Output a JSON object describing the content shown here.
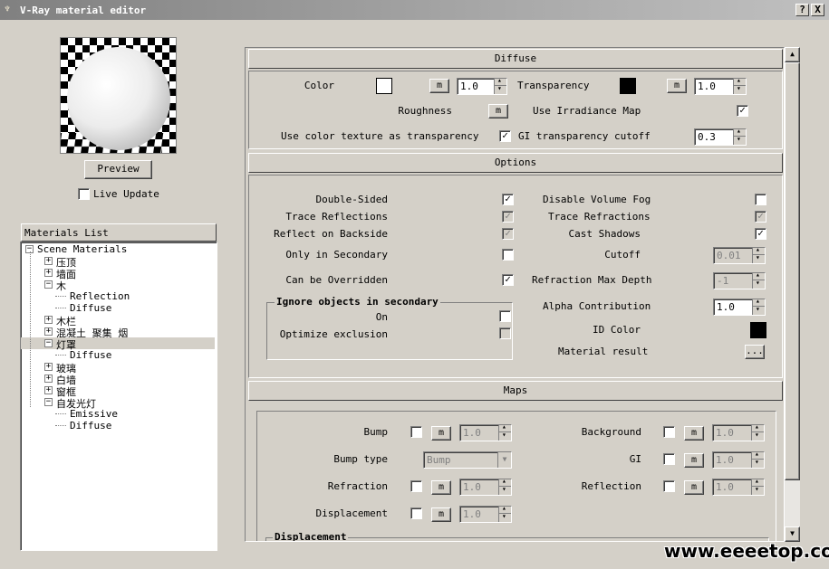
{
  "window": {
    "title": "V-Ray material editor",
    "help_label": "?",
    "close_label": "X"
  },
  "preview": {
    "button_label": "Preview",
    "live_update_label": "Live Update",
    "live_update_checked": false
  },
  "materials_list": {
    "header": "Materials List",
    "items": [
      {
        "label": "Scene Materials",
        "level": 0,
        "expander": "−"
      },
      {
        "label": "压顶",
        "level": 1,
        "expander": "+"
      },
      {
        "label": "墙面",
        "level": 1,
        "expander": "+"
      },
      {
        "label": "木",
        "level": 1,
        "expander": "−"
      },
      {
        "label": "Reflection",
        "level": 2,
        "expander": ""
      },
      {
        "label": "Diffuse",
        "level": 2,
        "expander": ""
      },
      {
        "label": "木栏",
        "level": 1,
        "expander": "+"
      },
      {
        "label": "混凝土_聚集_烟",
        "level": 1,
        "expander": "+"
      },
      {
        "label": "灯罩",
        "level": 1,
        "expander": "−",
        "selected": true
      },
      {
        "label": "Diffuse",
        "level": 2,
        "expander": ""
      },
      {
        "label": "玻璃",
        "level": 1,
        "expander": "+"
      },
      {
        "label": "白墙",
        "level": 1,
        "expander": "+"
      },
      {
        "label": "窗框",
        "level": 1,
        "expander": "+"
      },
      {
        "label": "自发光灯",
        "level": 1,
        "expander": "−"
      },
      {
        "label": "Emissive",
        "level": 2,
        "expander": ""
      },
      {
        "label": "Diffuse",
        "level": 2,
        "expander": ""
      }
    ]
  },
  "diffuse": {
    "header": "Diffuse",
    "color_label": "Color",
    "color_value": "#ffffff",
    "color_mult": "1.0",
    "transparency_label": "Transparency",
    "transparency_value": "#000000",
    "transparency_mult": "1.0",
    "roughness_label": "Roughness",
    "irradiance_label": "Use Irradiance Map",
    "irradiance_checked": true,
    "texture_transp_label": "Use color texture as transparency",
    "texture_transp_checked": true,
    "gi_cutoff_label": "GI transparency cutoff",
    "gi_cutoff_value": "0.3",
    "map_button": "m"
  },
  "options": {
    "header": "Options",
    "double_sided": "Double-Sided",
    "trace_reflections": "Trace Reflections",
    "reflect_backside": "Reflect on Backside",
    "only_secondary": "Only in Secondary",
    "can_override": "Can be Overridden",
    "disable_fog": "Disable Volume Fog",
    "trace_refractions": "Trace Refractions",
    "cast_shadows": "Cast Shadows",
    "cutoff_label": "Cutoff",
    "cutoff_value": "0.01",
    "refr_depth_label": "Refraction Max Depth",
    "refr_depth_value": "-1",
    "alpha_label": "Alpha Contribution",
    "alpha_value": "1.0",
    "id_color_label": "ID Color",
    "id_color_value": "#000000",
    "material_result_label": "Material result",
    "material_result_button": "...",
    "ignore_group_label": "Ignore objects in secondary",
    "on_label": "On",
    "optimize_label": "Optimize exclusion",
    "check_mark": "✓"
  },
  "maps": {
    "header": "Maps",
    "bump_label": "Bump",
    "bump_value": "1.0",
    "bump_type_label": "Bump type",
    "bump_type_value": "Bump",
    "refraction_label": "Refraction",
    "refraction_value": "1.0",
    "displacement_label": "Displacement",
    "displacement_value": "1.0",
    "background_label": "Background",
    "background_value": "1.0",
    "gi_label": "GI",
    "gi_value": "1.0",
    "reflection_label": "Reflection",
    "reflection_value": "1.0",
    "displacement_group_label": "Displacement"
  },
  "watermark": "www.eeeetop.com",
  "colors": {
    "face": "#d4d0c8",
    "highlight": "#ffffff",
    "shadow": "#808080",
    "dark": "#404040"
  }
}
